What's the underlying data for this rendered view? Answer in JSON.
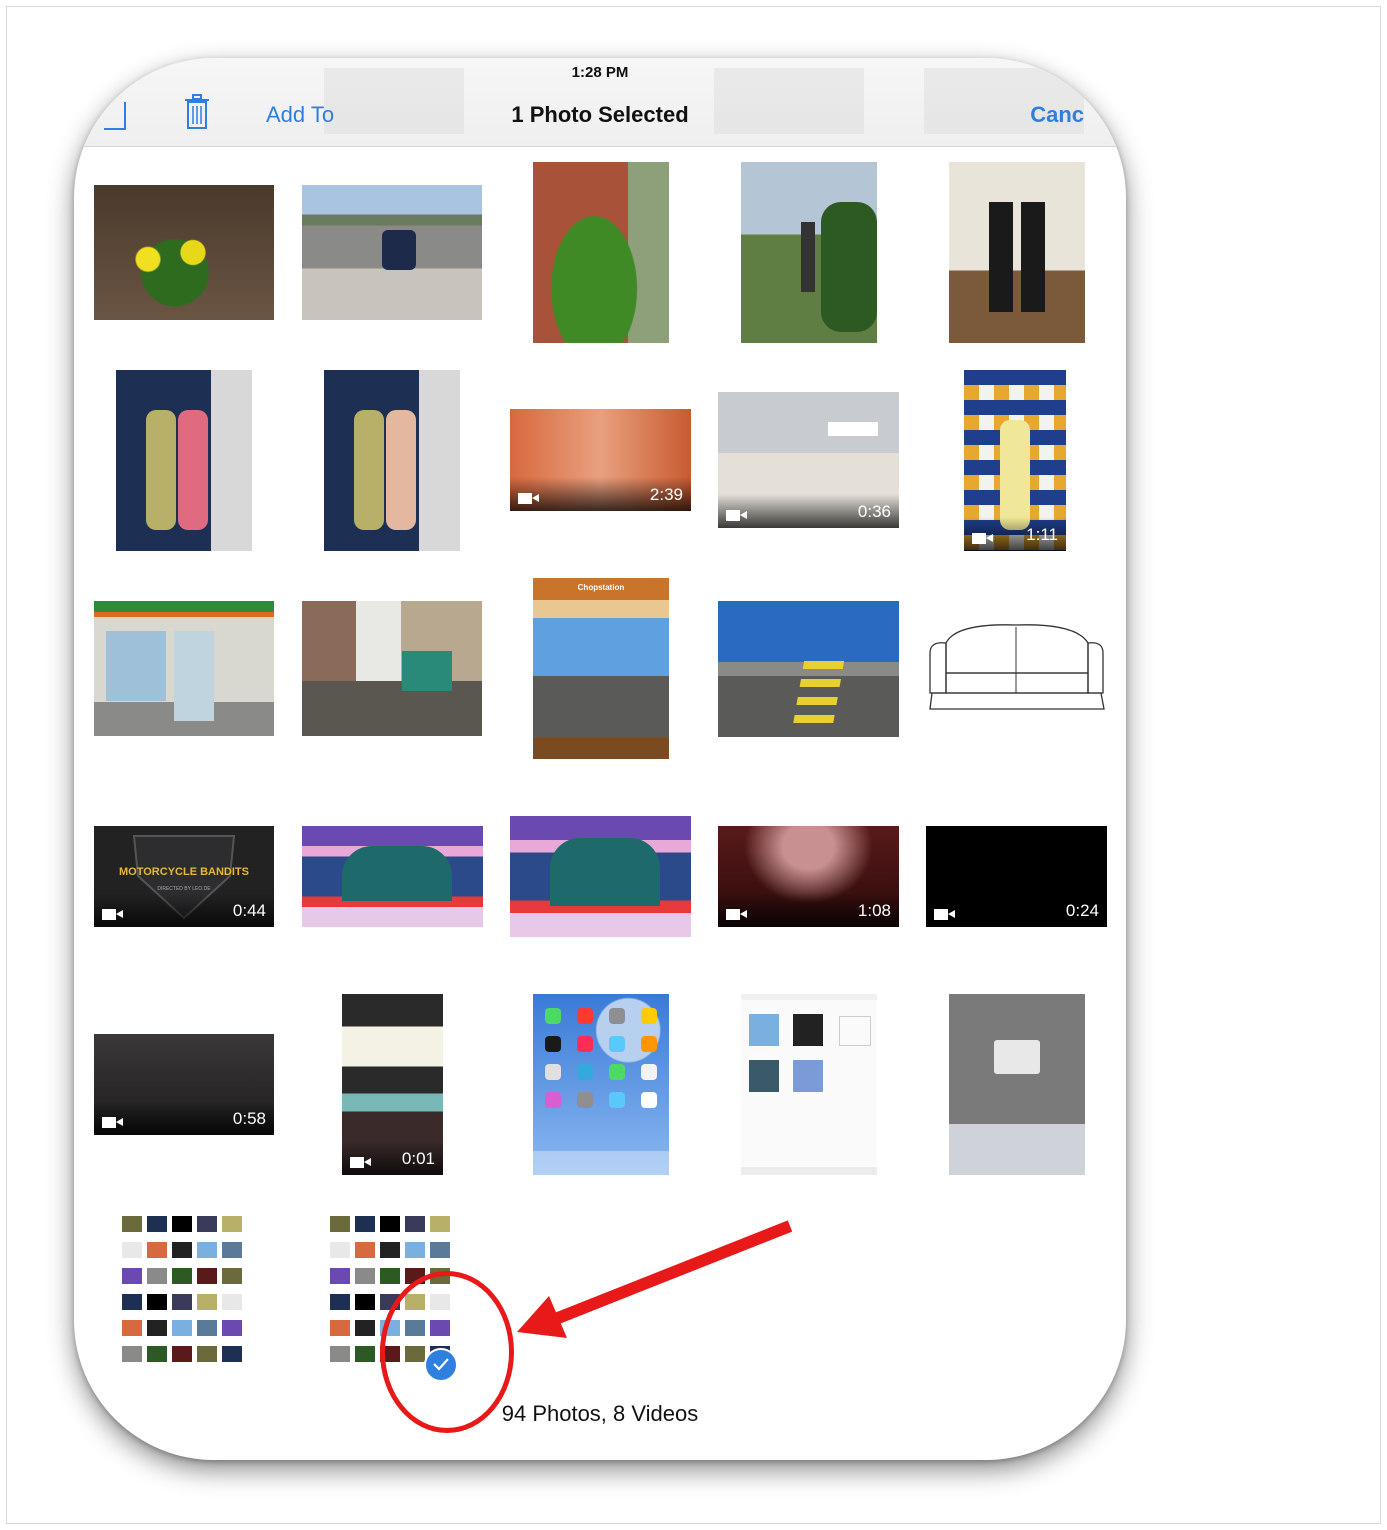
{
  "status_bar": {
    "time": "1:28 PM"
  },
  "nav": {
    "add_to": "Add To",
    "title": "1 Photo Selected",
    "cancel": "Canc"
  },
  "grid": {
    "videos": [
      {
        "duration": "2:39"
      },
      {
        "duration": "0:36"
      },
      {
        "duration": "1:11"
      },
      {
        "duration": "0:44"
      },
      {
        "duration": "1:08"
      },
      {
        "duration": "0:24"
      },
      {
        "duration": "0:58"
      },
      {
        "duration": "0:01"
      }
    ],
    "app_screens": {
      "chopstation_title": "Chopstation",
      "motorcycle_title": "MOTORCYCLE BANDITS",
      "motorcycle_sub": "DIRECTED BY LEO.DE"
    }
  },
  "footer": {
    "count": "94 Photos, 8 Videos"
  },
  "colors": {
    "accent": "#2f7fe0",
    "annotation": "#e81919"
  }
}
